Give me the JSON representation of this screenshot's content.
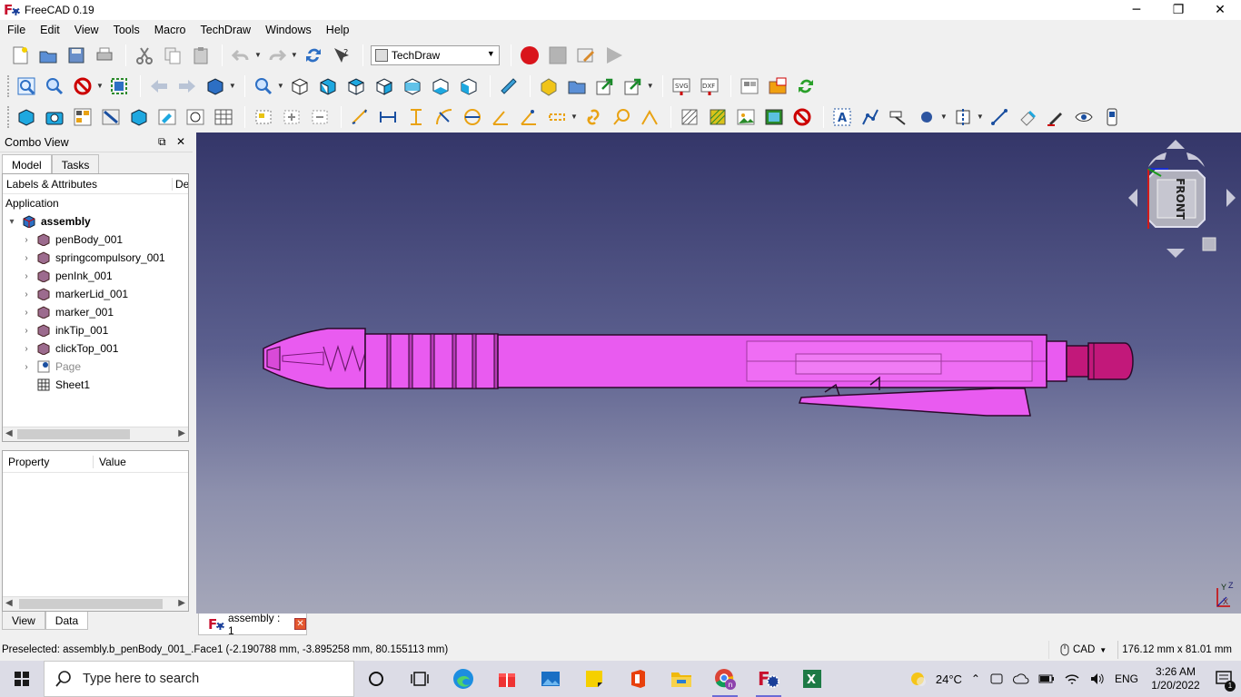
{
  "window": {
    "title": "FreeCAD 0.19",
    "minimize": "─",
    "maximize": "❐",
    "close": "✕"
  },
  "menu": [
    "File",
    "Edit",
    "View",
    "Tools",
    "Macro",
    "TechDraw",
    "Windows",
    "Help"
  ],
  "workbench": {
    "selected": "TechDraw"
  },
  "combo_view": {
    "title": "Combo View",
    "tabs": [
      "Model",
      "Tasks"
    ],
    "tree_header": {
      "labels": "Labels & Attributes",
      "description": "De"
    },
    "root": "Application",
    "document": "assembly",
    "items": [
      {
        "label": "penBody_001"
      },
      {
        "label": "springcompulsory_001"
      },
      {
        "label": "penInk_001"
      },
      {
        "label": "markerLid_001"
      },
      {
        "label": "marker_001"
      },
      {
        "label": "inkTip_001"
      },
      {
        "label": "clickTop_001"
      },
      {
        "label": "Page"
      },
      {
        "label": "Sheet1"
      }
    ],
    "property_header": {
      "property": "Property",
      "value": "Value"
    },
    "bottom_tabs": [
      "View",
      "Data"
    ]
  },
  "viewport": {
    "navcube_face": "FRONT",
    "axis": {
      "y": "Y",
      "z": "Z",
      "x": "X"
    },
    "colors": {
      "part": "#e95bf0",
      "edge": "#2a0a2a",
      "cap": "#c2187a"
    }
  },
  "doc_tab": {
    "label": "assembly : 1",
    "close": "✕"
  },
  "status": {
    "preselected": "Preselected: assembly.b_penBody_001_.Face1 (-2.190788 mm, -3.895258 mm, 80.155113 mm)",
    "nav_style": "CAD",
    "dimensions": "176.12 mm x 81.01 mm"
  },
  "taskbar": {
    "search_placeholder": "Type here to search",
    "weather": "24°C",
    "language": "ENG",
    "time": "3:26 AM",
    "date": "1/20/2022",
    "notifications": "1"
  },
  "icons": [
    "new-file-icon",
    "open-icon",
    "save-icon",
    "print-icon",
    "cut-icon",
    "copy-icon",
    "paste-icon",
    "undo-icon",
    "redo-icon",
    "refresh-icon",
    "whats-this-icon",
    "macro-record-icon",
    "macro-stop-icon",
    "macro-edit-icon",
    "macro-run-icon"
  ]
}
